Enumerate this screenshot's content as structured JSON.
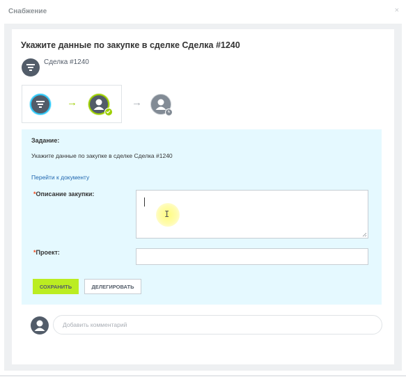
{
  "window": {
    "title": "Снабжение",
    "close": "×"
  },
  "task": {
    "heading": "Укажите данные по закупке в сделке Сделка #1240",
    "deal_name": "Сделка #1240",
    "section_title": "Задание:",
    "description": "Укажите данные по закупке в сделке Сделка #1240",
    "link": "Перейти к документу"
  },
  "flow": {
    "arrow": "→"
  },
  "form": {
    "required_mark": "*",
    "purchase_description_label": "Описание закупки:",
    "purchase_description_value": "",
    "project_label": "Проект:",
    "project_value": ""
  },
  "buttons": {
    "save": "СОХРАНИТЬ",
    "delegate": "ДЕЛЕГИРОВАТЬ"
  },
  "comment": {
    "placeholder": "Добавить комментарий"
  },
  "colors": {
    "accent_green": "#bbed21",
    "task_bg": "#e5f9ff",
    "link": "#2067b0",
    "required": "#f54819",
    "step_active": "#2fc6f6",
    "step_done": "#9dcf00"
  },
  "icons": [
    "filter-icon",
    "user-icon",
    "check-icon",
    "clock-icon",
    "text-cursor-icon",
    "resize-grip-icon"
  ]
}
